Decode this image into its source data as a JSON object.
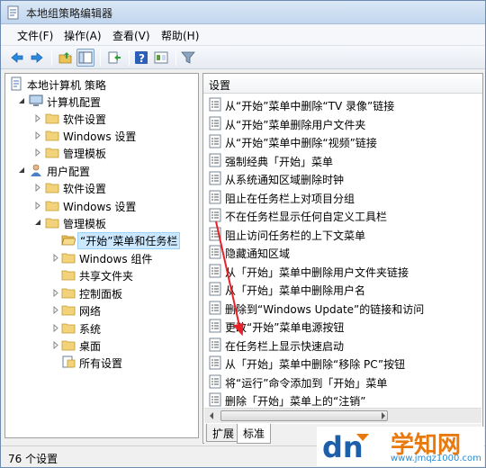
{
  "window": {
    "title": "本地组策略编辑器"
  },
  "menu": [
    {
      "label": "文件(F)"
    },
    {
      "label": "操作(A)"
    },
    {
      "label": "查看(V)"
    },
    {
      "label": "帮助(H)"
    }
  ],
  "toolbar": {
    "buttons": [
      "back-icon",
      "forward-icon",
      "up-folder-icon",
      "show-hide-tree-icon",
      "export-list-icon",
      "help-icon",
      "properties-icon",
      "filter-icon"
    ]
  },
  "tree": [
    {
      "label": "本地计算机 策略",
      "icon": "computer-policy-icon",
      "expander": "none"
    },
    {
      "label": "计算机配置",
      "icon": "computer-icon",
      "expander": "open"
    },
    {
      "label": "软件设置",
      "icon": "folder-icon",
      "expander": "closed"
    },
    {
      "label": "Windows 设置",
      "icon": "folder-icon",
      "expander": "closed"
    },
    {
      "label": "管理模板",
      "icon": "folder-icon",
      "expander": "closed"
    },
    {
      "label": "用户配置",
      "icon": "user-icon",
      "expander": "open"
    },
    {
      "label": "软件设置",
      "icon": "folder-icon",
      "expander": "closed"
    },
    {
      "label": "Windows 设置",
      "icon": "folder-icon",
      "expander": "closed"
    },
    {
      "label": "管理模板",
      "icon": "folder-icon",
      "expander": "open"
    },
    {
      "label": "“开始”菜单和任务栏",
      "icon": "folder-open-icon",
      "expander": "none",
      "selected": true
    },
    {
      "label": "Windows 组件",
      "icon": "folder-icon",
      "expander": "closed"
    },
    {
      "label": "共享文件夹",
      "icon": "folder-icon",
      "expander": "none"
    },
    {
      "label": "控制面板",
      "icon": "folder-icon",
      "expander": "closed"
    },
    {
      "label": "网络",
      "icon": "folder-icon",
      "expander": "closed"
    },
    {
      "label": "系统",
      "icon": "folder-icon",
      "expander": "closed"
    },
    {
      "label": "桌面",
      "icon": "folder-icon",
      "expander": "closed"
    },
    {
      "label": "所有设置",
      "icon": "all-settings-icon",
      "expander": "none"
    }
  ],
  "list": {
    "header": "设置",
    "items": [
      "从“开始”菜单中删除“TV 录像”链接",
      "从“开始”菜单删除用户文件夹",
      "从“开始”菜单中删除“视频”链接",
      "强制经典「开始」菜单",
      "从系统通知区域删除时钟",
      "阻止在任务栏上对项目分组",
      "不在任务栏显示任何自定义工具栏",
      "阻止访问任务栏的上下文菜单",
      "隐藏通知区域",
      "从「开始」菜单中删除用户文件夹链接",
      "从「开始」菜单中删除用户名",
      "删除到“Windows Update”的链接和访问",
      "更改“开始”菜单电源按钮",
      "在任务栏上显示快速启动",
      "从「开始」菜单中删除“移除 PC”按钮",
      "将“运行”命令添加到「开始」菜单",
      "删除「开始」菜单上的“注销”"
    ]
  },
  "tabs": [
    {
      "label": "扩展"
    },
    {
      "label": "标准"
    }
  ],
  "status": {
    "text": "76 个设置"
  },
  "watermark": {
    "logo": "dn",
    "title": "学知网",
    "url": "www.jmqz1000.com"
  },
  "colors": {
    "annotation_arrow": "#e8202a",
    "selection": "#cce8ff",
    "watermark_orange": "#e9790d",
    "watermark_blue": "#2a8bd0"
  }
}
